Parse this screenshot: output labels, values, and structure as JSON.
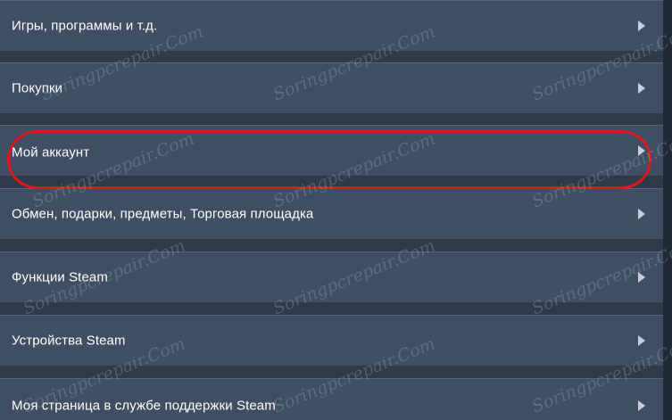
{
  "menu": {
    "items": [
      {
        "label": "Игры, программы и т.д."
      },
      {
        "label": "Покупки"
      },
      {
        "label": "Мой аккаунт"
      },
      {
        "label": "Обмен, подарки, предметы, Торговая площадка"
      },
      {
        "label": "Функции Steam"
      },
      {
        "label": "Устройства Steam"
      },
      {
        "label": "Моя страница в службе поддержки Steam"
      }
    ]
  },
  "watermark": {
    "text": "Soringpcrepair.Com"
  },
  "colors": {
    "item_background": "#3f4e62",
    "gap_background": "#2f3a48",
    "highlight": "#e0161e",
    "text": "#ffffff"
  }
}
